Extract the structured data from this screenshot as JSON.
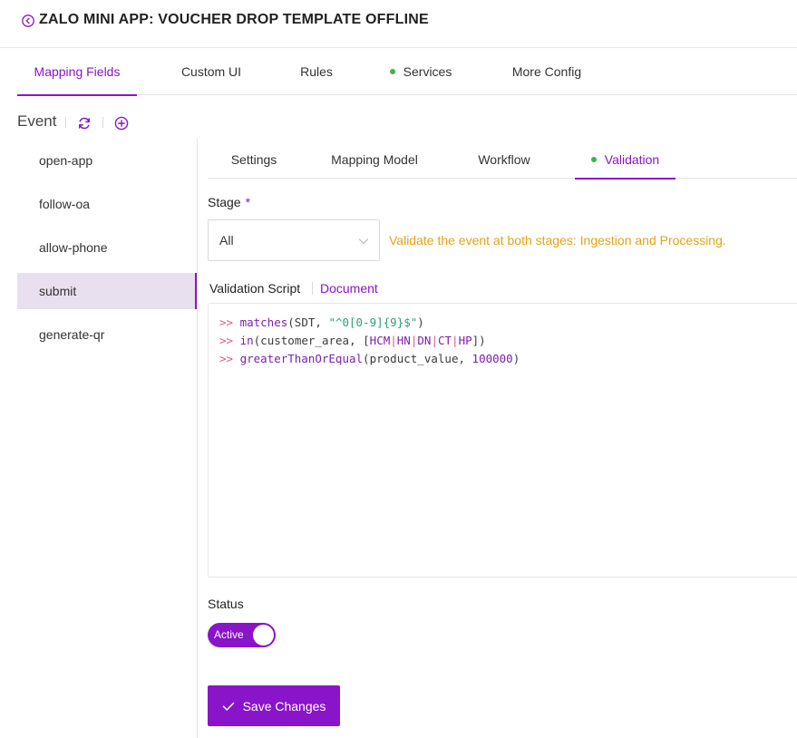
{
  "header": {
    "title": "ZALO MINI APP: VOUCHER DROP TEMPLATE OFFLINE",
    "back_icon": "back-circle-icon"
  },
  "top_tabs": [
    {
      "label": "Mapping Fields",
      "active": true,
      "dot": false
    },
    {
      "label": "Custom UI",
      "active": false,
      "dot": false
    },
    {
      "label": "Rules",
      "active": false,
      "dot": false
    },
    {
      "label": "Services",
      "active": false,
      "dot": true
    },
    {
      "label": "More Config",
      "active": false,
      "dot": false
    }
  ],
  "event_panel": {
    "title": "Event",
    "icons": [
      "refresh-icon",
      "add-circle-icon"
    ],
    "items": [
      {
        "label": "open-app",
        "active": false
      },
      {
        "label": "follow-oa",
        "active": false
      },
      {
        "label": "allow-phone",
        "active": false
      },
      {
        "label": "submit",
        "active": true
      },
      {
        "label": "generate-qr",
        "active": false
      }
    ]
  },
  "inner_tabs": [
    {
      "label": "Settings",
      "active": false,
      "dot": false
    },
    {
      "label": "Mapping Model",
      "active": false,
      "dot": false
    },
    {
      "label": "Workflow",
      "active": false,
      "dot": false
    },
    {
      "label": "Validation",
      "active": true,
      "dot": true
    }
  ],
  "stage": {
    "label": "Stage",
    "required_mark": "*",
    "selected": "All",
    "hint": "Validate the event at both stages: Ingestion and Processing."
  },
  "validation_script": {
    "label": "Validation Script",
    "document_link": "Document",
    "lines": [
      ">> matches(SDT, \"^0[0-9]{9}$\")",
      ">> in(customer_area, [HCM|HN|DN|CT|HP])",
      ">> greaterThanOrEqual(product_value, 100000)"
    ]
  },
  "status": {
    "label": "Status",
    "toggle_text": "Active",
    "on": true
  },
  "save_button": {
    "label": "Save Changes"
  },
  "colors": {
    "accent": "#8a14c9",
    "hint": "#e6a117",
    "dot": "#3cb44b",
    "active_bg": "#e9e0ef"
  }
}
